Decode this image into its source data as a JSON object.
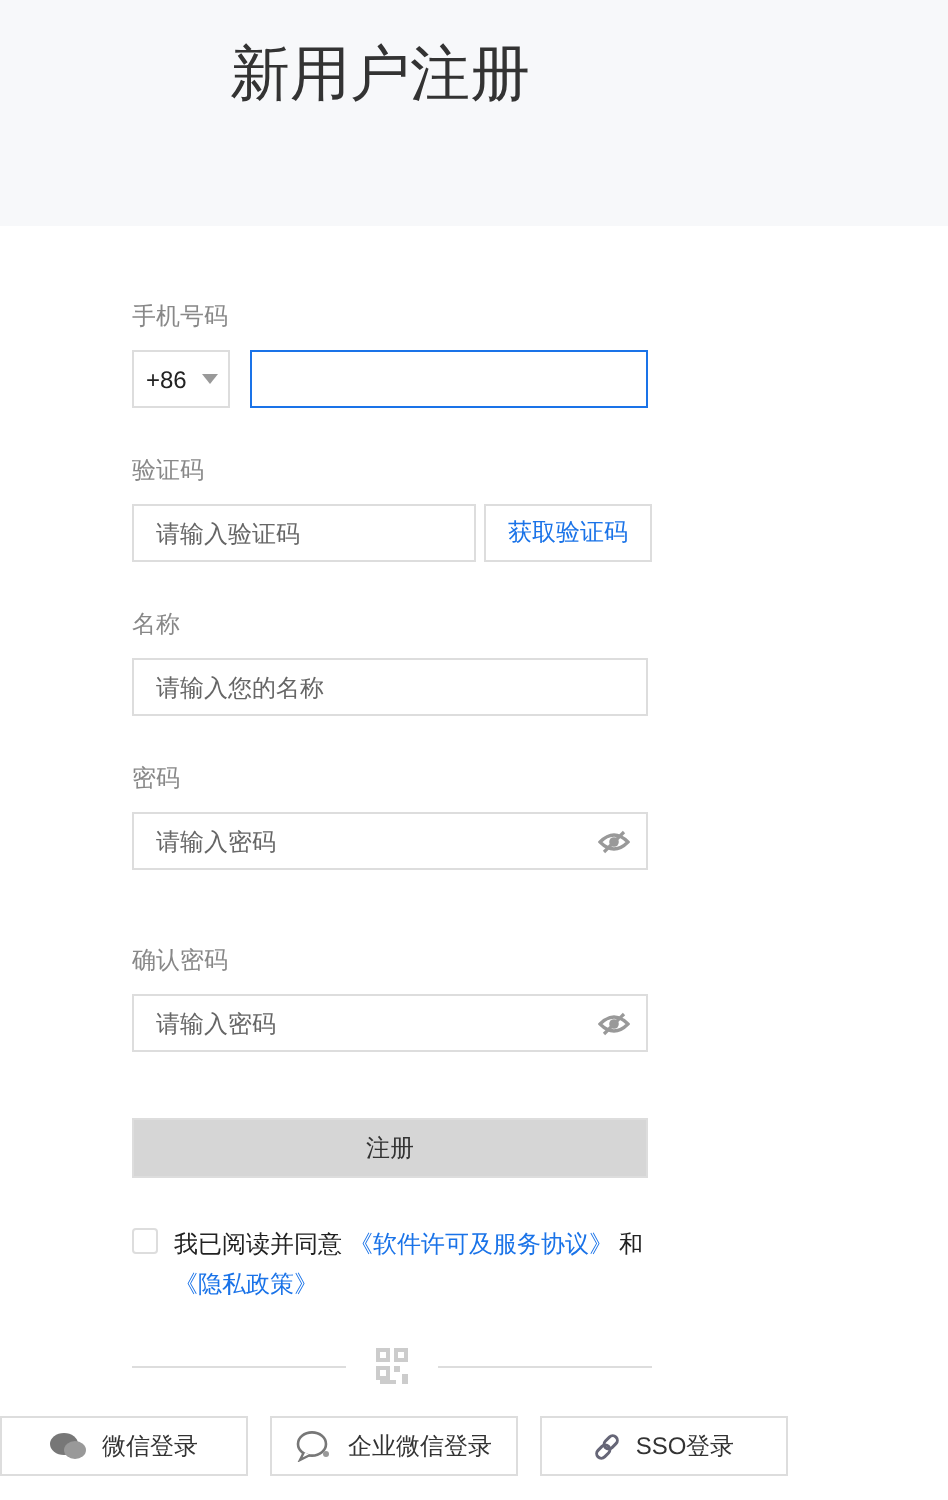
{
  "title": "新用户注册",
  "fields": [
    {
      "kind": "phone",
      "label": "手机号码",
      "country_code": "+86",
      "focused": true
    },
    {
      "kind": "code",
      "label": "验证码",
      "placeholder": "请输入验证码",
      "button": "获取验证码",
      "focused": false
    },
    {
      "kind": "text",
      "label": "名称",
      "placeholder": "请输入您的名称",
      "focused": false
    },
    {
      "kind": "password",
      "label": "密码",
      "placeholder": "请输入密码",
      "focused": false
    },
    {
      "kind": "password",
      "label": "确认密码",
      "placeholder": "请输入密码",
      "focused": false
    }
  ],
  "submit": {
    "label": "注册",
    "disabled": true
  },
  "agreement": {
    "checked": false,
    "segments": [
      {
        "kind": "text",
        "text": "我已阅读并同意 "
      },
      {
        "kind": "link",
        "text": "《软件许可及服务协议》"
      },
      {
        "kind": "text",
        "text": " 和"
      },
      {
        "kind": "link",
        "text": "《隐私政策》"
      }
    ]
  },
  "login_options": [
    {
      "kind": "wechat",
      "label": "微信登录"
    },
    {
      "kind": "wework",
      "label": "企业微信登录"
    },
    {
      "kind": "sso",
      "label": "SSO登录"
    }
  ]
}
